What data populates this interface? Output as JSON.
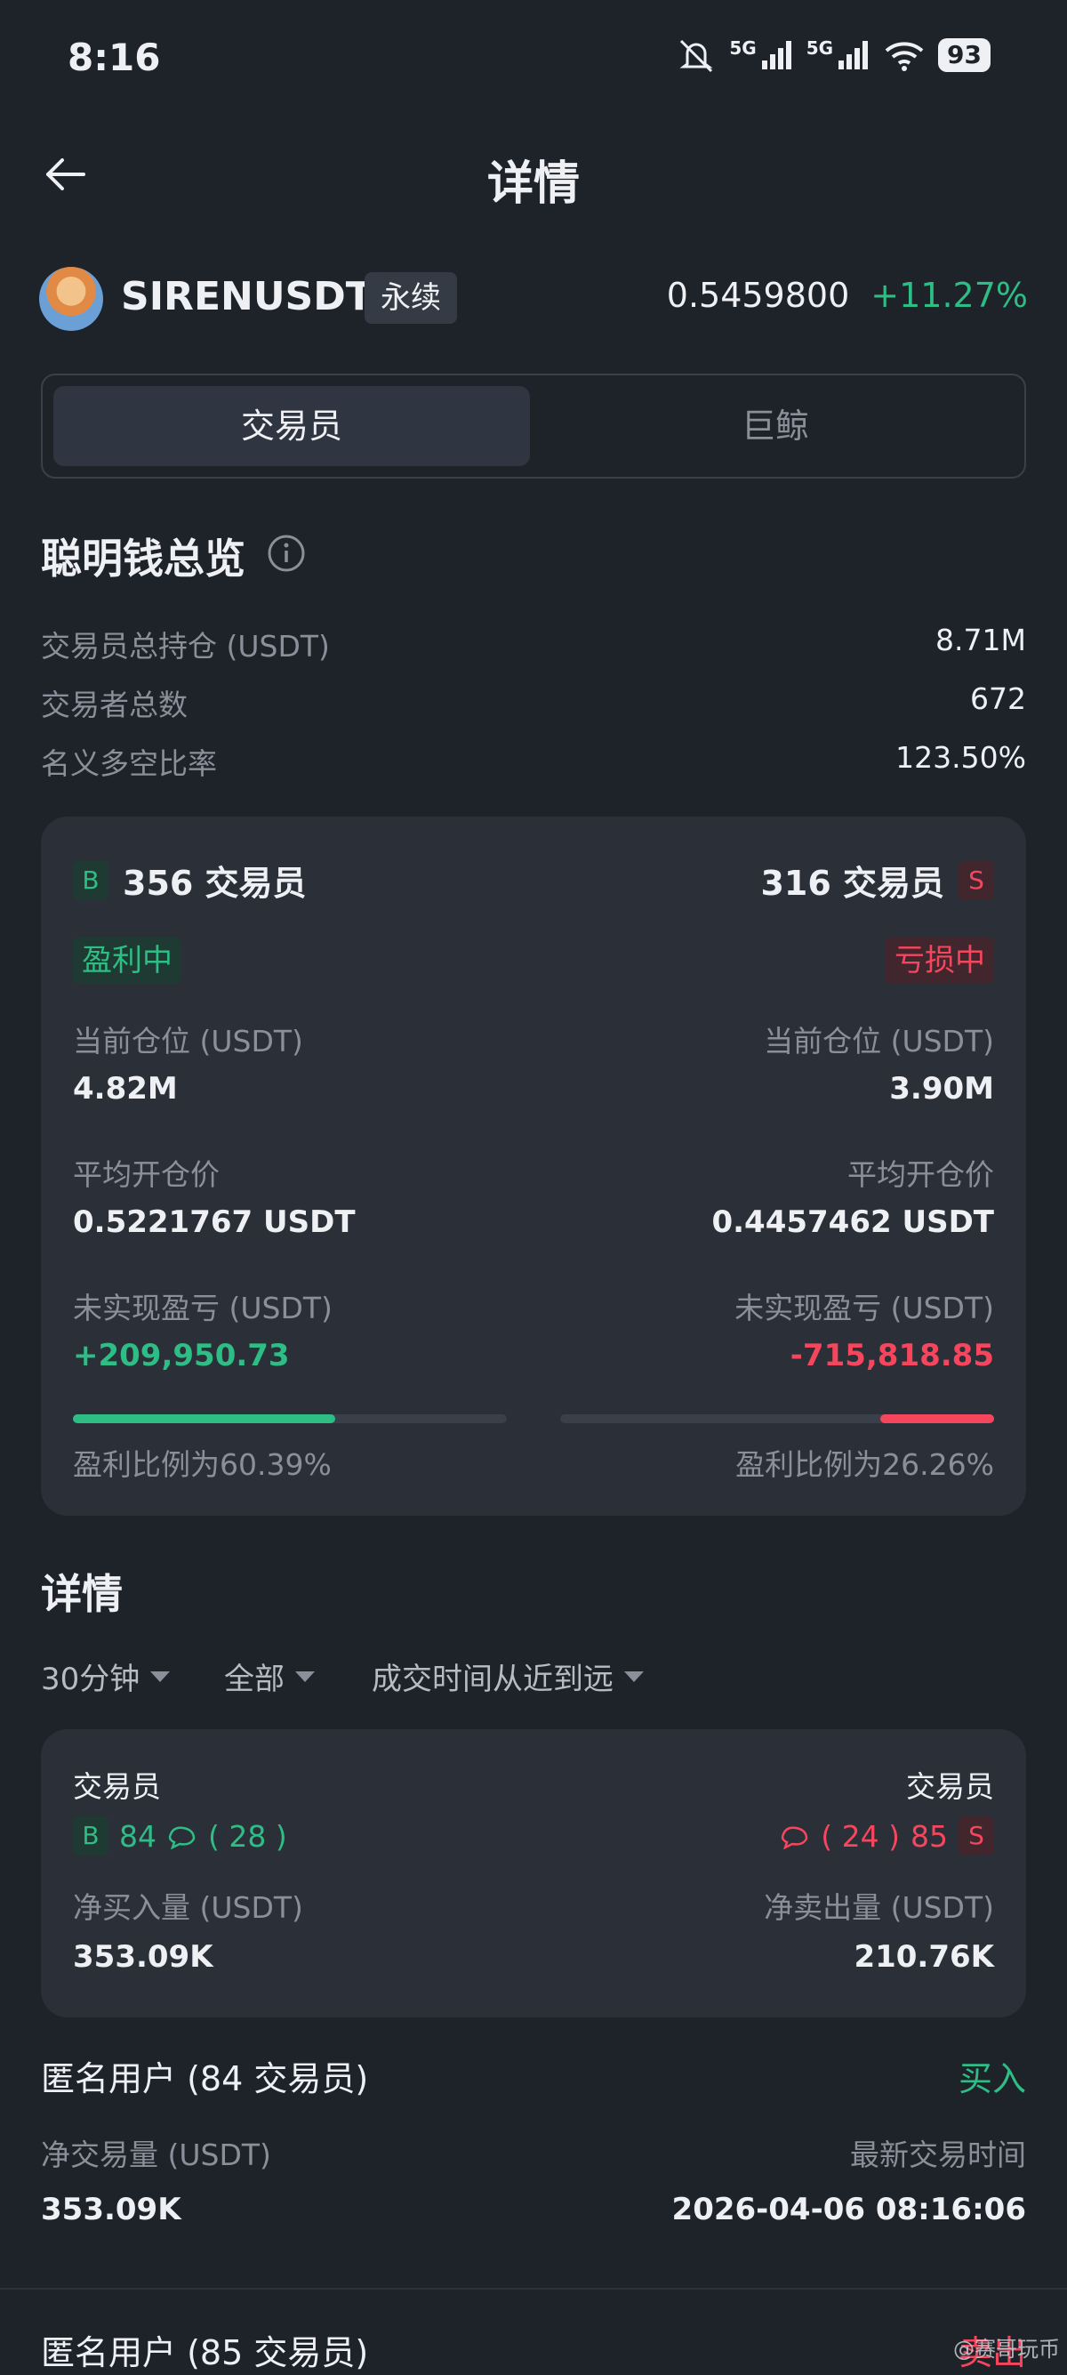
{
  "status_bar": {
    "time": "8:16",
    "network1": "5G",
    "network2": "5G",
    "battery": "93"
  },
  "header": {
    "title": "详情"
  },
  "ticker": {
    "symbol": "SIRENUSDT",
    "tag": "永续",
    "price": "0.5459800",
    "change": "+11.27%"
  },
  "tabs": [
    {
      "label": "交易员",
      "active": true
    },
    {
      "label": "巨鲸",
      "active": false
    }
  ],
  "overview": {
    "title": "聪明钱总览",
    "rows": [
      {
        "label": "交易员总持仓 (USDT)",
        "value": "8.71M"
      },
      {
        "label": "交易者总数",
        "value": "672"
      },
      {
        "label": "名义多空比率",
        "value": "123.50%"
      }
    ]
  },
  "long_short_card": {
    "long": {
      "badge": "B",
      "count_label": "356 交易员",
      "status": "盈利中",
      "position_label": "当前仓位 (USDT)",
      "position_value": "4.82M",
      "avg_label": "平均开仓价",
      "avg_value": "0.5221767 USDT",
      "pnl_label": "未实现盈亏 (USDT)",
      "pnl_value": "+209,950.73",
      "ratio_label": "盈利比例为60.39%",
      "ratio": 0.6039
    },
    "short": {
      "badge": "S",
      "count_label": "316 交易员",
      "status": "亏损中",
      "position_label": "当前仓位 (USDT)",
      "position_value": "3.90M",
      "avg_label": "平均开仓价",
      "avg_value": "0.4457462 USDT",
      "pnl_label": "未实现盈亏 (USDT)",
      "pnl_value": "-715,818.85",
      "ratio_label": "盈利比例为26.26%",
      "ratio": 0.2626
    }
  },
  "details": {
    "title": "详情",
    "filters": [
      "30分钟",
      "全部",
      "成交时间从近到远"
    ],
    "summary": {
      "left_title": "交易员",
      "right_title": "交易员",
      "buy_badge": "B",
      "buy_count": "84",
      "buy_whales": "( 28 )",
      "sell_badge": "S",
      "sell_count": "85",
      "sell_whales": "( 24 )",
      "buy_label": "净买入量 (USDT)",
      "buy_value": "353.09K",
      "sell_label": "净卖出量 (USDT)",
      "sell_value": "210.76K"
    },
    "trades": [
      {
        "user": "匿名用户 (84 交易员)",
        "action": "买入",
        "vol_label": "净交易量 (USDT)",
        "vol_value": "353.09K",
        "time_label": "最新交易时间",
        "time_value": "2026-04-06 08:16:06"
      },
      {
        "user": "匿名用户 (85 交易员)",
        "action": "卖出"
      }
    ]
  },
  "watermark": "@赛哥玩币"
}
